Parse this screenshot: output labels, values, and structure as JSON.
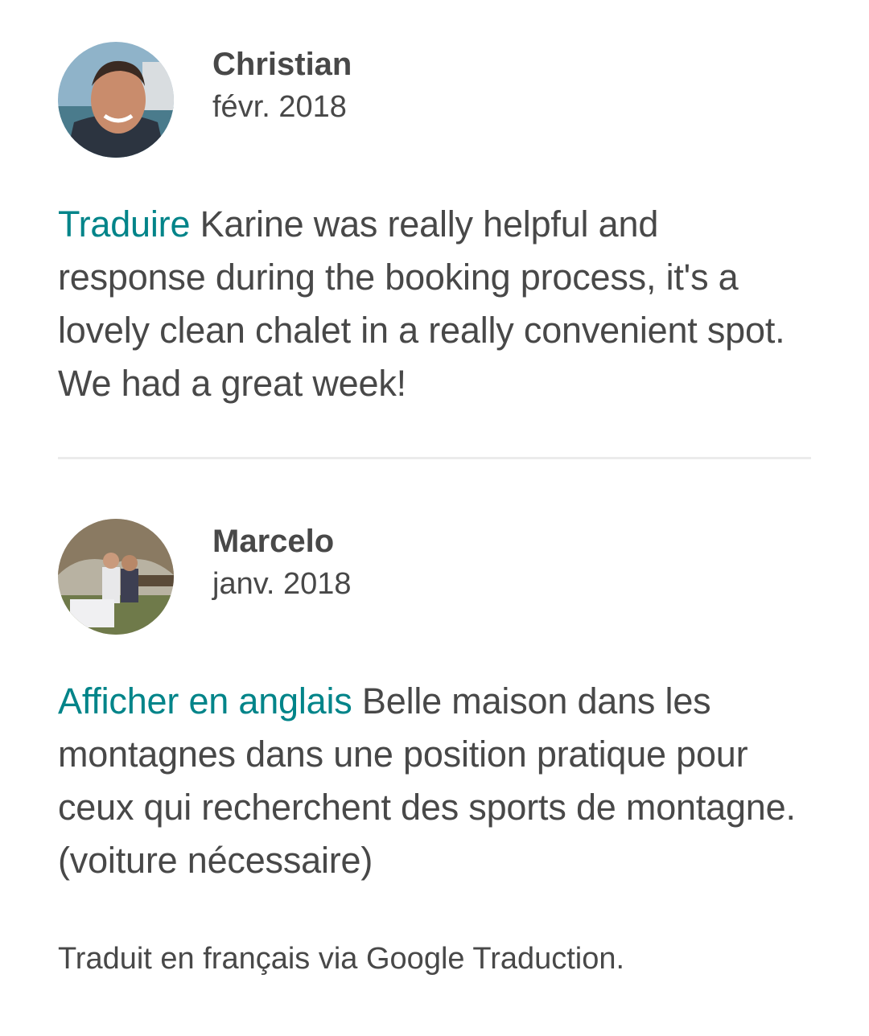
{
  "reviews": [
    {
      "name": "Christian",
      "date": "févr. 2018",
      "link_label": "Traduire",
      "text": "Karine was really helpful and response during the booking process, it's a lovely clean chalet in a really convenient spot. We had a great week!"
    },
    {
      "name": "Marcelo",
      "date": "janv. 2018",
      "link_label": "Afficher en anglais",
      "text": "Belle maison dans les montagnes dans une position pratique pour ceux qui recherchent des sports de montagne. (voiture nécessaire)"
    }
  ],
  "footnote": "Traduit en français via Google Traduction.",
  "colors": {
    "text": "#484848",
    "link": "#008489",
    "divider": "#ebebeb"
  }
}
